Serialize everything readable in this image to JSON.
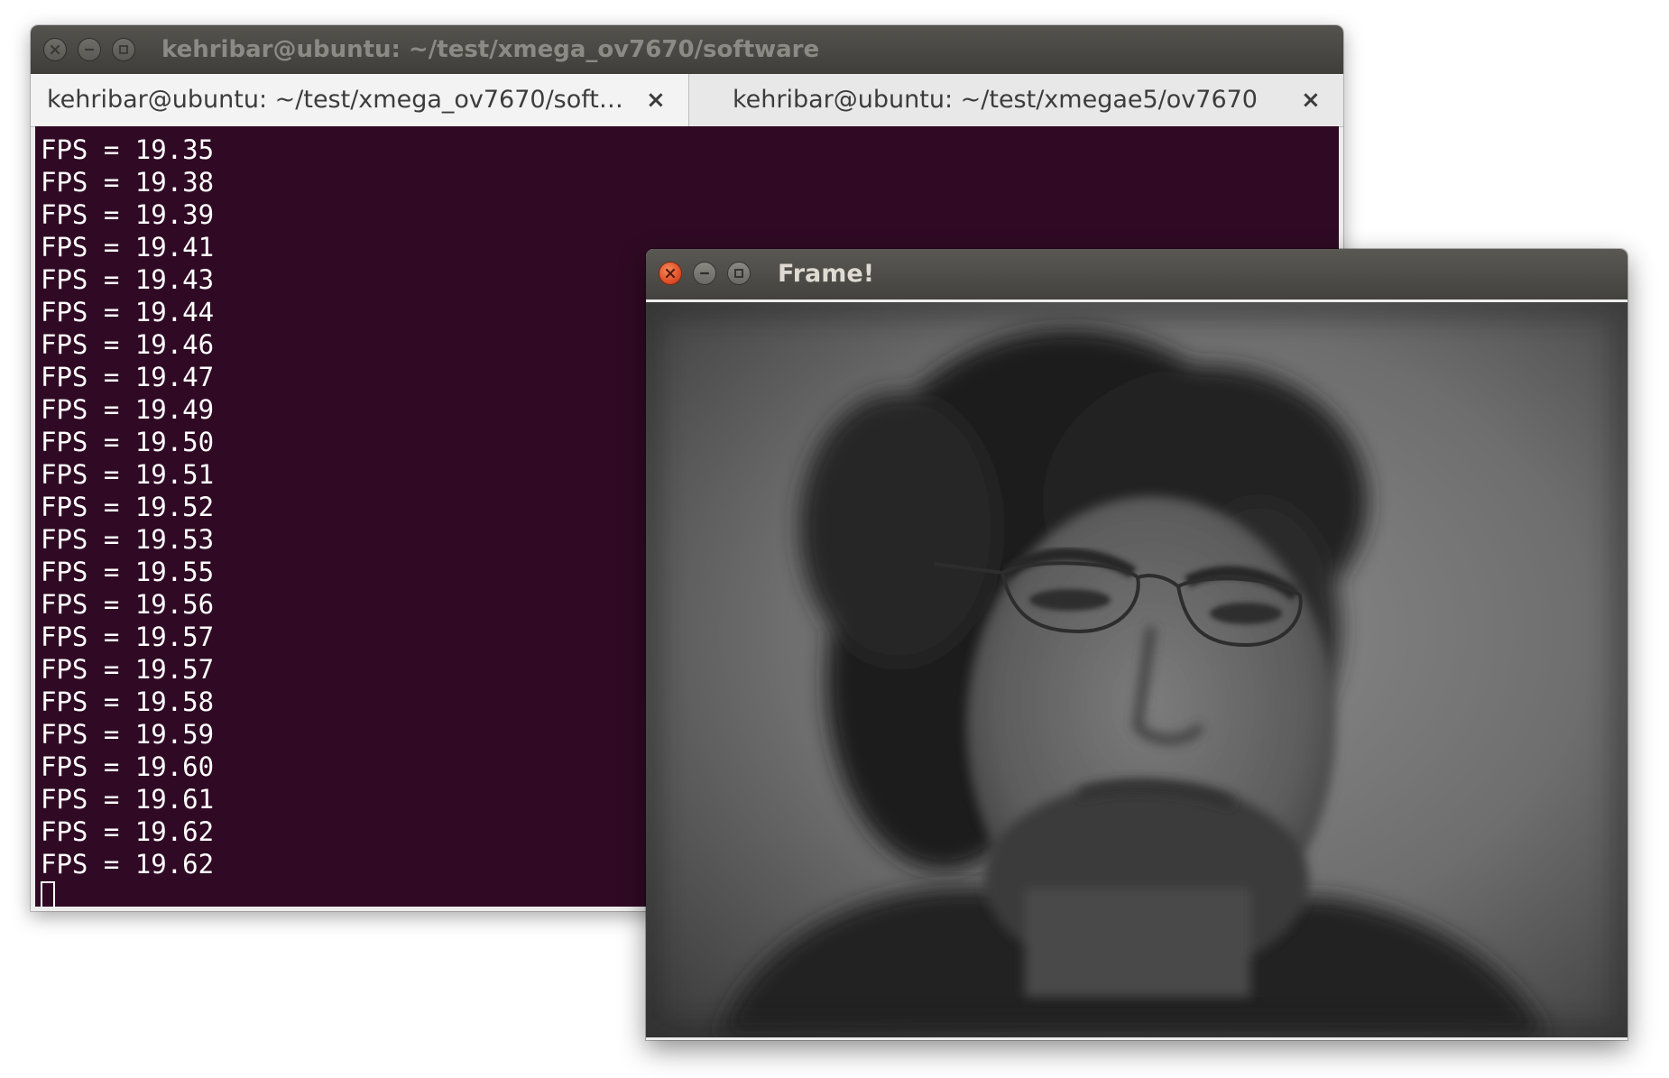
{
  "terminal": {
    "title": "kehribar@ubuntu: ~/test/xmega_ov7670/software",
    "tabs": [
      {
        "label": "kehribar@ubuntu: ~/test/xmega_ov7670/soft…",
        "close": "×"
      },
      {
        "label": "kehribar@ubuntu: ~/test/xmegae5/ov7670",
        "close": "×"
      }
    ],
    "lines": [
      "FPS = 19.35",
      "FPS = 19.38",
      "FPS = 19.39",
      "FPS = 19.41",
      "FPS = 19.43",
      "FPS = 19.44",
      "FPS = 19.46",
      "FPS = 19.47",
      "FPS = 19.49",
      "FPS = 19.50",
      "FPS = 19.51",
      "FPS = 19.52",
      "FPS = 19.53",
      "FPS = 19.55",
      "FPS = 19.56",
      "FPS = 19.57",
      "FPS = 19.57",
      "FPS = 19.58",
      "FPS = 19.59",
      "FPS = 19.60",
      "FPS = 19.61",
      "FPS = 19.62",
      "FPS = 19.62"
    ],
    "background_color": "#300a24",
    "text_color": "#ffffff"
  },
  "frame_window": {
    "title": "Frame!",
    "image_description_icon": "grayscale-camera-frame"
  },
  "window_controls": {
    "close_icon": "close-icon",
    "minimize_icon": "minimize-icon",
    "maximize_icon": "maximize-icon",
    "close_active_color": "#e95420"
  }
}
